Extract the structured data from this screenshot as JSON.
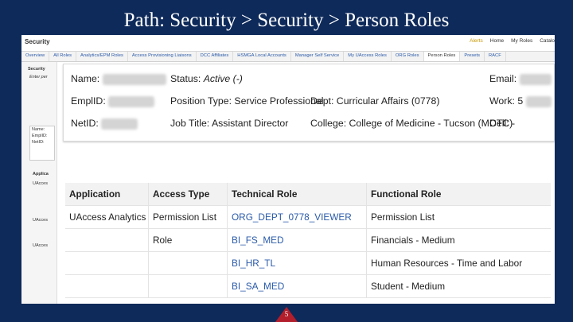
{
  "slide": {
    "title": "Path: Security > Security > Person Roles",
    "page_number": "5"
  },
  "app": {
    "name": "Security",
    "topnav": [
      "Alerts",
      "Home",
      "My Roles",
      "Catalo"
    ],
    "tabs": [
      "Overview",
      "All Roles",
      "Analytics/EPM Roles",
      "Access Provisioning Liaisons",
      "DCC Affiliates",
      "HSMGA Local Accounts",
      "Manager Self Service",
      "My UAccess Roles",
      "ORG Roles",
      "Person Roles",
      "Presets",
      "RACF"
    ],
    "active_tab": "Person Roles"
  },
  "left_panel": {
    "title": "Security",
    "subtitle": "Enter per",
    "fields": [
      "Name:",
      "EmplID:",
      "NetID:"
    ],
    "app_heading": "Applica",
    "items": [
      "UAcces",
      "UAcces",
      "UAcces"
    ]
  },
  "person": {
    "name_label": "Name:",
    "emplid_label": "EmplID:",
    "netid_label": "NetID:",
    "status_label": "Status:",
    "status_value": "Active (-)",
    "position_type": "Position Type: Service Professional",
    "job_title": "Job Title: Assistant Director",
    "dept": "Dept: Curricular Affairs (0778)",
    "college": "College: College of Medicine - Tucson (MDTC)",
    "email_label": "Email:",
    "work_label": "Work:",
    "work_partial": "5",
    "cell": "Cell: -"
  },
  "roles_table": {
    "headers": [
      "Application",
      "Access Type",
      "Technical Role",
      "Functional Role"
    ],
    "rows": [
      {
        "application": "UAccess Analytics",
        "access_type": "Permission List",
        "technical_role": "ORG_DEPT_0778_VIEWER",
        "functional_role": "Permission List"
      },
      {
        "application": "",
        "access_type": "Role",
        "technical_role": "BI_FS_MED",
        "functional_role": "Financials - Medium"
      },
      {
        "application": "",
        "access_type": "",
        "technical_role": "BI_HR_TL",
        "functional_role": "Human Resources - Time and Labor"
      },
      {
        "application": "",
        "access_type": "",
        "technical_role": "BI_SA_MED",
        "functional_role": "Student - Medium"
      }
    ]
  },
  "colors": {
    "slide_background": "#0e2a5a",
    "link": "#2a5aa8",
    "page_marker": "#b21e2b"
  }
}
